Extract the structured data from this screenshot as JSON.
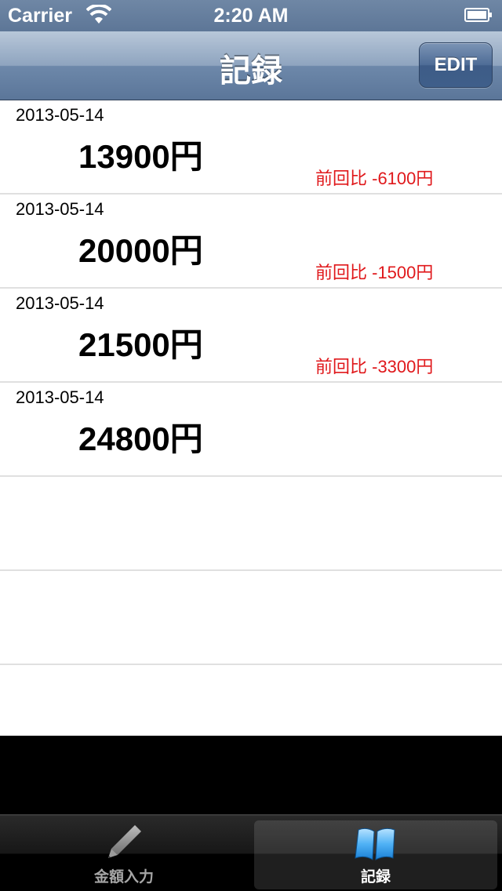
{
  "status_bar": {
    "carrier": "Carrier",
    "time": "2:20 AM"
  },
  "nav_bar": {
    "title": "記録",
    "edit_label": "EDIT"
  },
  "records": [
    {
      "date": "2013-05-14",
      "amount": "13900円",
      "diff": "前回比 -6100円"
    },
    {
      "date": "2013-05-14",
      "amount": "20000円",
      "diff": "前回比 -1500円"
    },
    {
      "date": "2013-05-14",
      "amount": "21500円",
      "diff": "前回比 -3300円"
    },
    {
      "date": "2013-05-14",
      "amount": "24800円",
      "diff": ""
    }
  ],
  "tab_bar": {
    "tabs": [
      {
        "label": "金額入力",
        "icon": "pencil-icon",
        "selected": false
      },
      {
        "label": "記録",
        "icon": "book-icon",
        "selected": true
      }
    ]
  },
  "colors": {
    "diff_text": "#e0181b",
    "nav_accent": "#5b7699"
  }
}
